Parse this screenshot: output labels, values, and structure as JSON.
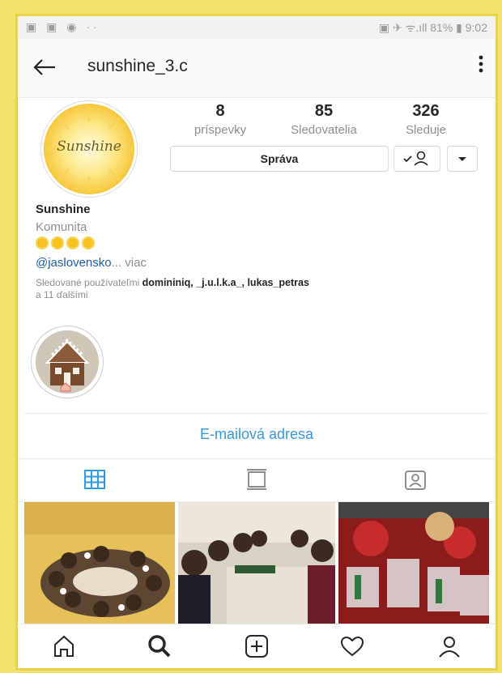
{
  "status_bar": {
    "left_icons": "▣ ▣ ◉ ··",
    "right_text": "▣ ✈ ᯤ.ıll 81% ▮ 9:02"
  },
  "header": {
    "back_icon": "arrow-left-icon",
    "username": "sunshine_3.c",
    "menu_icon": "more-vertical-icon"
  },
  "profile": {
    "avatar_text": "Sunshine",
    "stats": [
      {
        "value": "8",
        "label": "príspevky"
      },
      {
        "value": "85",
        "label": "Sledovatelia"
      },
      {
        "value": "326",
        "label": "Sleduje"
      }
    ],
    "message_button": "Správa",
    "name": "Sunshine",
    "category": "Komunita",
    "emoji_count": 4,
    "mention": "@jaslovensko",
    "more": "... viac",
    "followed_prefix": "Sledované používateľmi ",
    "followed_users": "domininiq, _j.u.l.k.a_, lukas_petras",
    "followed_suffix": "a 11 ďalšími"
  },
  "email_link": "E-mailová adresa",
  "tabs": [
    "grid-icon",
    "feed-icon",
    "tagged-icon"
  ],
  "nav": [
    "home-icon",
    "search-icon",
    "add-post-icon",
    "heart-icon",
    "profile-icon"
  ],
  "colors": {
    "link_blue": "#3897d6",
    "mention_blue": "#1f5fa3",
    "frame_yellow": "#f3e36a"
  }
}
